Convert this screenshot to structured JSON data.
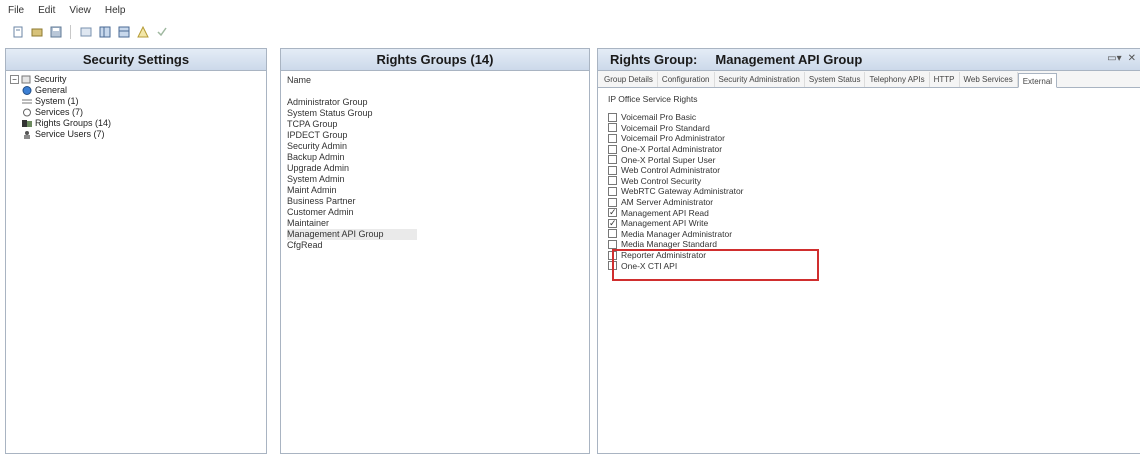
{
  "menu": [
    "File",
    "Edit",
    "View",
    "Help"
  ],
  "left_pane": {
    "title": "Security Settings",
    "tree": {
      "root": "Security",
      "items": [
        "General",
        "System (1)",
        "Services (7)",
        "Rights Groups (14)",
        "Service Users (7)"
      ]
    }
  },
  "mid_pane": {
    "title": "Rights Groups (14)",
    "column_header": "Name",
    "items": [
      "Administrator Group",
      "System Status Group",
      "TCPA Group",
      "IPDECT Group",
      "Security Admin",
      "Backup Admin",
      "Upgrade Admin",
      "System Admin",
      "Maint Admin",
      "Business Partner",
      "Customer Admin",
      "Maintainer",
      "Management API Group",
      "CfgRead"
    ],
    "selected_index": 12
  },
  "right_pane": {
    "title_label": "Rights Group:",
    "title_value": "Management API Group",
    "tabs": [
      "Group Details",
      "Configuration",
      "Security Administration",
      "System Status",
      "Telephony APIs",
      "HTTP",
      "Web Services",
      "External"
    ],
    "active_tab": "External",
    "section_title": "IP Office Service Rights",
    "rights": [
      {
        "label": "Voicemail Pro Basic",
        "checked": false
      },
      {
        "label": "Voicemail Pro Standard",
        "checked": false
      },
      {
        "label": "Voicemail Pro Administrator",
        "checked": false
      },
      {
        "label": "One-X Portal Administrator",
        "checked": false
      },
      {
        "label": "One-X Portal Super User",
        "checked": false
      },
      {
        "label": "Web Control Administrator",
        "checked": false
      },
      {
        "label": "Web Control Security",
        "checked": false
      },
      {
        "label": "WebRTC Gateway Administrator",
        "checked": false
      },
      {
        "label": "AM Server Administrator",
        "checked": false
      },
      {
        "label": "Management API Read",
        "checked": true
      },
      {
        "label": "Management API Write",
        "checked": true
      },
      {
        "label": "Media Manager Administrator",
        "checked": false
      },
      {
        "label": "Media Manager Standard",
        "checked": false
      },
      {
        "label": "Reporter Administrator",
        "checked": false
      },
      {
        "label": "One-X CTI API",
        "checked": false
      }
    ]
  }
}
